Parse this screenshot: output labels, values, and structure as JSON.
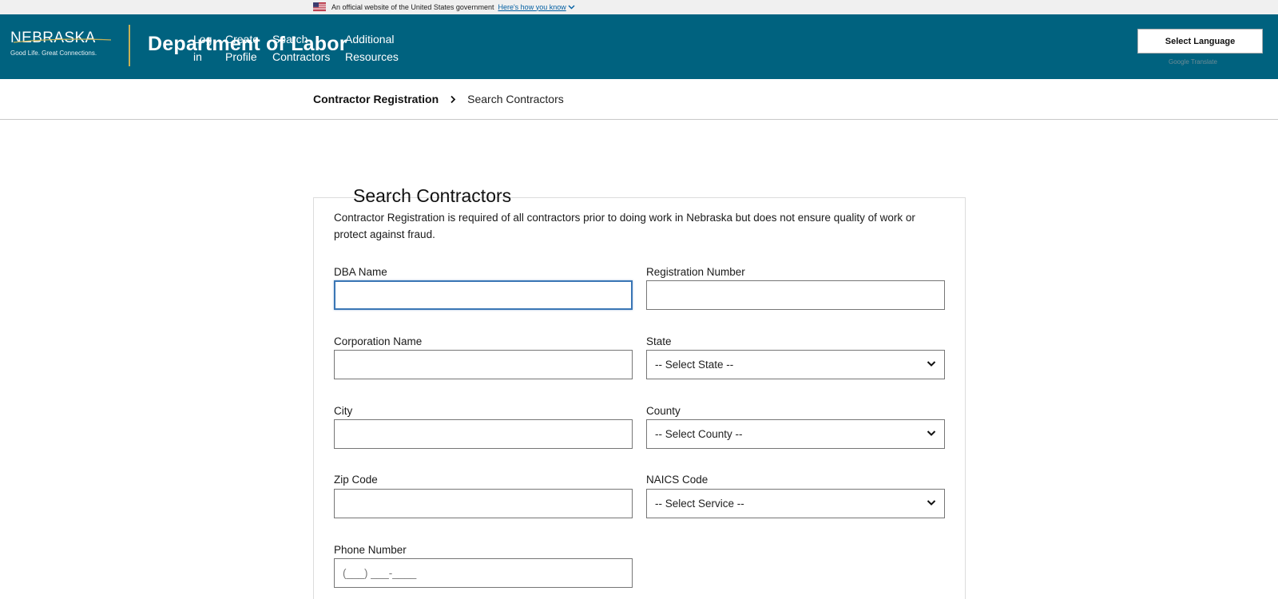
{
  "gov_banner": {
    "text": "An official website of the United States government",
    "link": "Here's how you know"
  },
  "header": {
    "logo_word": "NEBRASKA",
    "logo_tagline": "Good Life. Great Connections.",
    "title": "Department of Labor",
    "nav": [
      {
        "line1": "Log",
        "line2": "in"
      },
      {
        "line1": "Create",
        "line2": "Profile"
      },
      {
        "line1": "Search",
        "line2": "Contractors"
      },
      {
        "line1": "Additional",
        "line2": "Resources"
      }
    ],
    "language_button": "Select Language",
    "translate_credit": "Google Translate"
  },
  "breadcrumb": {
    "parent": "Contractor Registration",
    "current": "Search Contractors"
  },
  "form": {
    "title": "Search Contractors",
    "notice": "Contractor Registration is required of all contractors prior to doing work in Nebraska but does not ensure quality of work or protect against fraud.",
    "dba_label": "DBA Name",
    "dba_value": "",
    "registration_label": "Registration Number",
    "registration_value": "",
    "corporation_label": "Corporation Name",
    "corporation_value": "",
    "state_label": "State",
    "state_value": "-- Select State --",
    "city_label": "City",
    "city_value": "",
    "county_label": "County",
    "county_value": "-- Select County --",
    "zip_label": "Zip Code",
    "zip_value": "",
    "naics_label": "NAICS Code",
    "naics_value": "-- Select Service --",
    "phone_label": "Phone Number",
    "phone_placeholder": "(___) ___-____"
  },
  "colors": {
    "header_bg": "#00627f",
    "divider_gold": "#c7b256",
    "focus_blue": "#3a76b5",
    "gov_link": "#005ea2"
  }
}
